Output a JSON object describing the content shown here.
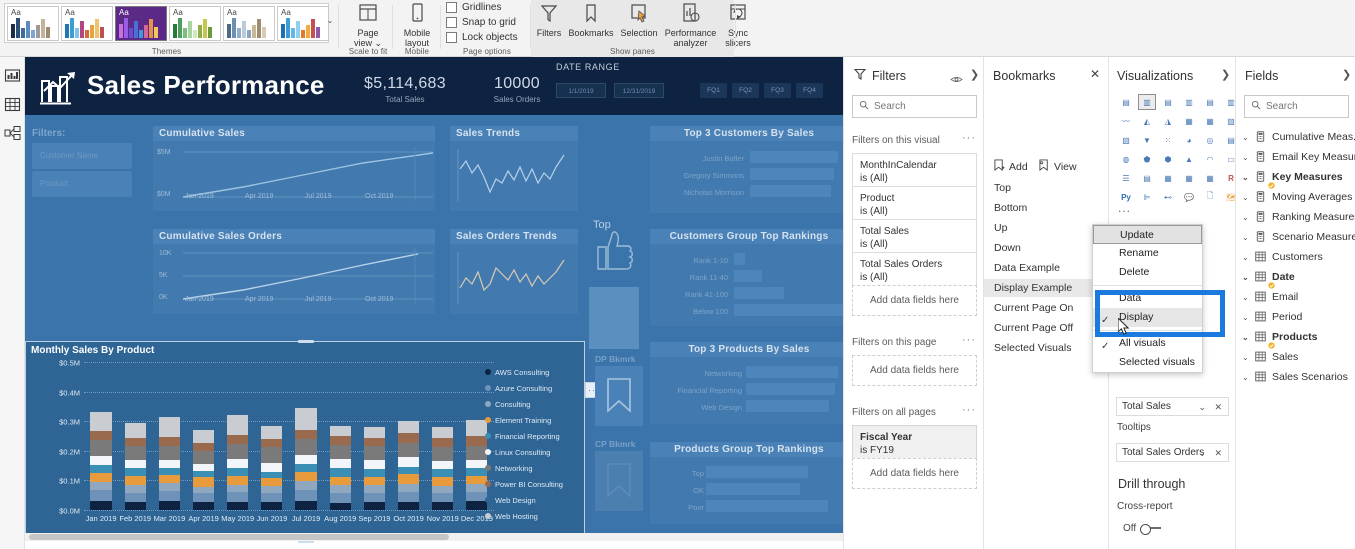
{
  "ribbon": {
    "themes": {
      "group_label": "Themes",
      "tiles": [
        {
          "name": "theme-default",
          "aa": "Aa",
          "bg": "#ffffff",
          "bars": [
            "#1b2f4b",
            "#2f4f76",
            "#3d6b9e",
            "#5d8bbd",
            "#7fa6ce",
            "#9b9b9b",
            "#c4b39a",
            "#9e8a6e"
          ]
        },
        {
          "name": "theme-colorful",
          "aa": "Aa",
          "bg": "#ffffff",
          "bars": [
            "#1f77b4",
            "#3f9bd6",
            "#7fc3ea",
            "#b4467f",
            "#d46a3c",
            "#e8a33d",
            "#f0c46a",
            "#c0504d"
          ]
        },
        {
          "name": "theme-purple",
          "aa": "Aa",
          "bg": "#5b2a86",
          "bars": [
            "#c96fe0",
            "#9b5de5",
            "#6a4bd0",
            "#4a6fd8",
            "#3f9bd6",
            "#d6679b",
            "#e8914a",
            "#efc75e"
          ]
        },
        {
          "name": "theme-green",
          "aa": "Aa",
          "bg": "#ffffff",
          "bars": [
            "#2b7a3d",
            "#4aa05c",
            "#79c07e",
            "#a8d5a0",
            "#d0e8c0",
            "#8fae4a",
            "#c2c94d",
            "#6b9b3a"
          ]
        },
        {
          "name": "theme-muted",
          "aa": "Aa",
          "bg": "#ffffff",
          "bars": [
            "#4a6a8a",
            "#6f8fae",
            "#94b0c9",
            "#b9cadb",
            "#8aa4ba",
            "#c9b79a",
            "#a08c70",
            "#d8cbb4"
          ]
        },
        {
          "name": "theme-vivid",
          "aa": "Aa",
          "bg": "#ffffff",
          "bars": [
            "#1f6fb4",
            "#3f9bd6",
            "#62b8e8",
            "#8fd0f0",
            "#e07a2f",
            "#efae3c",
            "#c94f4f",
            "#8e5aa8"
          ]
        }
      ],
      "more_glyph": "⌄"
    },
    "scale_to_fit": {
      "group_label": "Scale to fit",
      "page_view_label": "Page\nview ⌄",
      "page_view_line1": "Page",
      "page_view_line2": "view ⌄"
    },
    "mobile": {
      "group_label": "Mobile",
      "mobile_layout_line1": "Mobile",
      "mobile_layout_line2": "layout"
    },
    "page_options": {
      "group_label": "Page options",
      "checkboxes": [
        "Gridlines",
        "Snap to grid",
        "Lock objects"
      ]
    },
    "show_panes": {
      "group_label": "Show panes",
      "buttons": [
        {
          "label": "Filters",
          "icon": "filter-icon",
          "active": false
        },
        {
          "label": "Bookmarks",
          "icon": "bookmark-icon",
          "active": false
        },
        {
          "label": "Selection",
          "icon": "selection-icon",
          "active": false
        },
        {
          "label": "Performance\nanalyzer",
          "line1": "Performance",
          "line2": "analyzer",
          "icon": "performance-icon",
          "active": false
        },
        {
          "label": "Sync\nslicers",
          "line1": "Sync",
          "line2": "slicers",
          "icon": "sync-slicers-icon",
          "active": false
        }
      ]
    }
  },
  "leftnav": {
    "items": [
      {
        "name": "report-view",
        "icon": "report-chart-icon"
      },
      {
        "name": "data-view",
        "icon": "table-grid-icon"
      },
      {
        "name": "model-view",
        "icon": "model-relationship-icon"
      }
    ]
  },
  "report": {
    "header": {
      "title": "Sales Performance",
      "logo_icon": "sales-growth-chart-icon",
      "kpis": [
        {
          "value": "$5,114,683",
          "label": "Total Sales"
        },
        {
          "value": "10000",
          "label": "Sales Orders"
        }
      ],
      "date_range": {
        "label": "DATE RANGE",
        "start": "1/1/2019",
        "end": "12/31/2019"
      },
      "quarter_buttons": [
        "FQ1",
        "FQ2",
        "FQ3",
        "FQ4"
      ]
    },
    "filters_label": "Filters:",
    "slicers": [
      {
        "label": "Customer Name"
      },
      {
        "label": "Product"
      }
    ],
    "panels": [
      {
        "title": "Cumulative Sales",
        "yticks": [
          "$5M",
          "$0M"
        ],
        "xticks": [
          "Jan 2019",
          "Apr 2019",
          "Jul 2019",
          "Oct 2019"
        ]
      },
      {
        "title": "Cumulative Sales Orders",
        "yticks": [
          "10K",
          "5K",
          "0K"
        ],
        "xticks": [
          "Jan 2019",
          "Apr 2019",
          "Jul 2019",
          "Oct 2019"
        ]
      },
      {
        "title": "Sales Trends"
      },
      {
        "title": "Sales Orders Trends"
      }
    ],
    "top_customers": {
      "title": "Top 3 Customers By Sales",
      "rows": [
        {
          "label": "Justin Butler",
          "pct": 100
        },
        {
          "label": "Gregory Simmons",
          "pct": 95
        },
        {
          "label": "Nicholas Morrison",
          "pct": 92
        }
      ]
    },
    "customers_rankings": {
      "title": "Customers Group Top Rankings",
      "rows": [
        {
          "label": "Rank 1-10",
          "pct": 10
        },
        {
          "label": "Rank 11-40",
          "pct": 25
        },
        {
          "label": "Rank 41-100",
          "pct": 45
        },
        {
          "label": "Below 100",
          "pct": 100
        }
      ]
    },
    "top_products": {
      "title": "Top 3 Products By Sales",
      "rows": [
        {
          "label": "Networking",
          "pct": 100
        },
        {
          "label": "Financial Reporting",
          "pct": 97
        },
        {
          "label": "Web Design",
          "pct": 90
        }
      ]
    },
    "products_rankings": {
      "title": "Products Group Top Rankings",
      "rows": [
        {
          "label": "Top",
          "pct": 82
        },
        {
          "label": "OK",
          "pct": 76
        },
        {
          "label": "Poor",
          "pct": 98
        }
      ]
    },
    "thumb_label": "Top",
    "bookmark_holders": [
      {
        "label": "DP Bkmrk"
      },
      {
        "label": "CP Bkmrk"
      }
    ],
    "visual_header_icons": [
      "filter-icon",
      "focus-mode-icon",
      "more-options-icon"
    ]
  },
  "chart_data": {
    "type": "bar",
    "title": "Monthly Sales By Product",
    "stacked": true,
    "xlabel": "",
    "ylabel": "",
    "ylim": [
      0,
      0.5
    ],
    "grid": true,
    "yticks": [
      "$0.0M",
      "$0.1M",
      "$0.2M",
      "$0.3M",
      "$0.4M",
      "$0.5M"
    ],
    "ytick_values": [
      0.0,
      0.1,
      0.2,
      0.3,
      0.4,
      0.5
    ],
    "categories": [
      "Jan 2019",
      "Feb 2019",
      "Mar 2019",
      "Apr 2019",
      "May 2019",
      "Jun 2019",
      "Jul 2019",
      "Aug 2019",
      "Sep 2019",
      "Oct 2019",
      "Nov 2019",
      "Dec 2019"
    ],
    "legend_position": "right",
    "series": [
      {
        "name": "AWS Consulting",
        "color": "#0d2341",
        "values": [
          0.03,
          0.028,
          0.029,
          0.027,
          0.028,
          0.026,
          0.031,
          0.025,
          0.027,
          0.028,
          0.026,
          0.029
        ]
      },
      {
        "name": "Azure Consulting",
        "color": "#6f93b8",
        "values": [
          0.037,
          0.031,
          0.035,
          0.029,
          0.033,
          0.032,
          0.038,
          0.033,
          0.031,
          0.034,
          0.03,
          0.033
        ]
      },
      {
        "name": "Consulting",
        "color": "#8fa8bf",
        "values": [
          0.029,
          0.024,
          0.026,
          0.023,
          0.025,
          0.023,
          0.028,
          0.026,
          0.025,
          0.026,
          0.024,
          0.025
        ]
      },
      {
        "name": "Element Training",
        "color": "#e89b3c",
        "values": [
          0.03,
          0.033,
          0.028,
          0.031,
          0.03,
          0.026,
          0.031,
          0.029,
          0.03,
          0.034,
          0.033,
          0.029
        ]
      },
      {
        "name": "Financial Reporting",
        "color": "#3b8fb5",
        "values": [
          0.027,
          0.026,
          0.025,
          0.022,
          0.027,
          0.021,
          0.026,
          0.028,
          0.027,
          0.025,
          0.025,
          0.026
        ]
      },
      {
        "name": "Linux Consulting",
        "color": "#f2f6fa",
        "values": [
          0.029,
          0.028,
          0.026,
          0.025,
          0.029,
          0.031,
          0.031,
          0.03,
          0.029,
          0.032,
          0.029,
          0.027
        ]
      },
      {
        "name": "Networking",
        "color": "#7a7a7a",
        "values": [
          0.053,
          0.046,
          0.048,
          0.043,
          0.05,
          0.055,
          0.054,
          0.049,
          0.047,
          0.046,
          0.046,
          0.048
        ]
      },
      {
        "name": "Power BI Consulting",
        "color": "#9a6a4f",
        "values": [
          0.033,
          0.026,
          0.03,
          0.026,
          0.031,
          0.025,
          0.033,
          0.029,
          0.028,
          0.034,
          0.029,
          0.032
        ]
      },
      {
        "name": "Web Design",
        "color": "#2e6595",
        "values": [
          0.0,
          0.0,
          0.0,
          0.0,
          0.0,
          0.0,
          0.0,
          0.0,
          0.0,
          0.0,
          0.0,
          0.0
        ]
      },
      {
        "name": "Web Hosting",
        "color": "#c9cdd2",
        "values": [
          0.063,
          0.053,
          0.068,
          0.044,
          0.067,
          0.045,
          0.073,
          0.035,
          0.038,
          0.042,
          0.038,
          0.056
        ]
      }
    ]
  },
  "filters_pane": {
    "title": "Filters",
    "icons": {
      "hide": "eye-icon",
      "collapse": "chevron-right-icon"
    },
    "search_placeholder": "Search",
    "sections": [
      {
        "label": "Filters on this visual",
        "cards": [
          {
            "field": "MonthInCalendar",
            "value": "is (All)",
            "bold": false
          },
          {
            "field": "Product",
            "value": "is (All)",
            "bold": false
          },
          {
            "field": "Total Sales",
            "value": "is (All)",
            "bold": false
          },
          {
            "field": "Total Sales Orders",
            "value": "is (All)",
            "bold": false
          }
        ],
        "drop_label": "Add data fields here"
      },
      {
        "label": "Filters on this page",
        "cards": [],
        "drop_label": "Add data fields here"
      },
      {
        "label": "Filters on all pages",
        "cards": [
          {
            "field": "Fiscal Year",
            "value": "is FY19",
            "bold": true
          }
        ],
        "drop_label": "Add data fields here"
      }
    ]
  },
  "bookmarks_pane": {
    "title": "Bookmarks",
    "close_icon": "close-icon",
    "toolbar": [
      {
        "label": "Add",
        "icon": "add-bookmark-icon"
      },
      {
        "label": "View",
        "icon": "view-bookmark-icon"
      }
    ],
    "items": [
      {
        "label": "Top",
        "selected": false
      },
      {
        "label": "Bottom",
        "selected": false
      },
      {
        "label": "Up",
        "selected": false
      },
      {
        "label": "Down",
        "selected": false
      },
      {
        "label": "Data Example",
        "selected": false
      },
      {
        "label": "Display Example",
        "selected": true
      },
      {
        "label": "Current Page On",
        "selected": false
      },
      {
        "label": "Current Page Off",
        "selected": false
      },
      {
        "label": "Selected Visuals",
        "selected": false
      }
    ]
  },
  "context_menu": {
    "items": [
      {
        "label": "Update",
        "highlighted": true,
        "checked": false
      },
      {
        "label": "Rename",
        "highlighted": false,
        "checked": false
      },
      {
        "label": "Delete",
        "highlighted": false,
        "checked": false
      }
    ],
    "group_data_display": [
      {
        "label": "Data",
        "checked": false,
        "hovered": false
      },
      {
        "label": "Display",
        "checked": true,
        "hovered": true
      }
    ],
    "group_visuals": [
      {
        "label": "All visuals",
        "checked": true,
        "hovered": false
      },
      {
        "label": "Selected visuals",
        "checked": false,
        "hovered": false
      }
    ],
    "check_glyph": "✓",
    "highlight_color": "#1a7ae0"
  },
  "visualizations_pane": {
    "title": "Visualizations",
    "collapse_icon": "chevron-right-icon",
    "icons": [
      {
        "name": "stacked-bar-chart-icon",
        "selected": false
      },
      {
        "name": "stacked-column-chart-icon",
        "selected": true
      },
      {
        "name": "clustered-bar-chart-icon",
        "selected": false
      },
      {
        "name": "clustered-column-chart-icon",
        "selected": false
      },
      {
        "name": "100-stacked-bar-chart-icon",
        "selected": false
      },
      {
        "name": "100-stacked-column-chart-icon",
        "selected": false
      },
      {
        "name": "line-chart-icon",
        "selected": false
      },
      {
        "name": "area-chart-icon",
        "selected": false
      },
      {
        "name": "stacked-area-chart-icon",
        "selected": false
      },
      {
        "name": "line-stacked-column-chart-icon",
        "selected": false
      },
      {
        "name": "line-clustered-column-chart-icon",
        "selected": false
      },
      {
        "name": "ribbon-chart-icon",
        "selected": false
      },
      {
        "name": "waterfall-chart-icon",
        "selected": false
      },
      {
        "name": "funnel-chart-icon",
        "selected": false
      },
      {
        "name": "scatter-chart-icon",
        "selected": false
      },
      {
        "name": "pie-chart-icon",
        "selected": false
      },
      {
        "name": "donut-chart-icon",
        "selected": false
      },
      {
        "name": "treemap-icon",
        "selected": false
      },
      {
        "name": "map-icon",
        "selected": false
      },
      {
        "name": "filled-map-icon",
        "selected": false
      },
      {
        "name": "shape-map-icon",
        "selected": false
      },
      {
        "name": "arcgis-map-icon",
        "selected": false
      },
      {
        "name": "gauge-icon",
        "selected": false
      },
      {
        "name": "card-icon",
        "selected": false
      },
      {
        "name": "multi-row-card-icon",
        "selected": false
      },
      {
        "name": "kpi-icon",
        "selected": false
      },
      {
        "name": "slicer-icon",
        "selected": false
      },
      {
        "name": "table-icon",
        "selected": false
      },
      {
        "name": "matrix-icon",
        "selected": false
      },
      {
        "name": "r-script-visual-icon",
        "selected": false
      },
      {
        "name": "python-visual-icon",
        "selected": false
      },
      {
        "name": "key-influencers-icon",
        "selected": false
      },
      {
        "name": "decomposition-tree-icon",
        "selected": false
      },
      {
        "name": "qna-icon",
        "selected": false
      },
      {
        "name": "paginated-report-icon",
        "selected": false
      },
      {
        "name": "get-more-visuals-icon",
        "selected": false
      }
    ],
    "more_dots": "...",
    "wells": [
      {
        "label": "Total Sales",
        "type": "field",
        "controls": "⌄ ✕"
      },
      {
        "label": "Tooltips",
        "type": "section"
      },
      {
        "label": "Total Sales Orders",
        "type": "field",
        "controls": "⌄ ✕"
      }
    ],
    "drill_through": {
      "title": "Drill through",
      "cross_report_label": "Cross-report",
      "cross_report_state": "Off"
    }
  },
  "fields_pane": {
    "title": "Fields",
    "collapse_icon": "chevron-right-icon",
    "search_placeholder": "Search",
    "items": [
      {
        "label": "Cumulative Meas...",
        "icon": "measure-table-icon",
        "bold": false
      },
      {
        "label": "Email Key Measur...",
        "icon": "measure-table-icon",
        "bold": false
      },
      {
        "label": "Key Measures",
        "icon": "measure-table-icon",
        "bold": true
      },
      {
        "label": "Moving Averages",
        "icon": "measure-table-icon",
        "bold": false
      },
      {
        "label": "Ranking Measures",
        "icon": "measure-table-icon",
        "bold": false
      },
      {
        "label": "Scenario Measures",
        "icon": "measure-table-icon",
        "bold": false
      },
      {
        "label": "Customers",
        "icon": "table-icon",
        "bold": false
      },
      {
        "label": "Date",
        "icon": "table-icon",
        "bold": true
      },
      {
        "label": "Email",
        "icon": "table-icon",
        "bold": false
      },
      {
        "label": "Period",
        "icon": "table-icon",
        "bold": false
      },
      {
        "label": "Products",
        "icon": "table-icon",
        "bold": true
      },
      {
        "label": "Sales",
        "icon": "table-icon",
        "bold": false
      },
      {
        "label": "Sales Scenarios",
        "icon": "table-icon",
        "bold": false
      }
    ]
  }
}
